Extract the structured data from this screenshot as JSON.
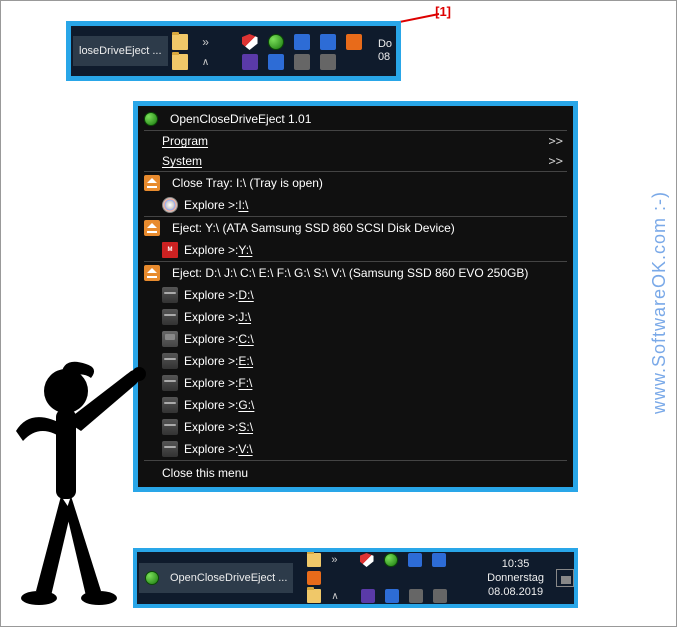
{
  "annotation": {
    "label": "[1]"
  },
  "topbar": {
    "task_label": "loseDriveEject ...",
    "clock": "Do\n08"
  },
  "menu": {
    "title": "OpenCloseDriveEject 1.01",
    "program": {
      "label": "Program",
      "chev": ">>"
    },
    "system": {
      "label": "System",
      "chev": ">>"
    },
    "close_tray": "Close Tray: I:\\ (Tray is open)",
    "explore_i": {
      "pre": "Explore >: ",
      "drive": "I:\\"
    },
    "eject_y": "Eject: Y:\\  (ATA Samsung SSD 860 SCSI Disk Device)",
    "explore_y": {
      "pre": "Explore >: ",
      "drive": "Y:\\"
    },
    "eject_multi": "Eject: D:\\ J:\\ C:\\ E:\\ F:\\ G:\\ S:\\ V:\\  (Samsung SSD 860 EVO 250GB)",
    "explore_d": {
      "pre": "Explore >: ",
      "drive": "D:\\"
    },
    "explore_j": {
      "pre": "Explore >: ",
      "drive": "J:\\"
    },
    "explore_c": {
      "pre": "Explore >: ",
      "drive": "C:\\"
    },
    "explore_e": {
      "pre": "Explore >: ",
      "drive": "E:\\"
    },
    "explore_f": {
      "pre": "Explore >: ",
      "drive": "F:\\"
    },
    "explore_g": {
      "pre": "Explore >: ",
      "drive": "G:\\"
    },
    "explore_s": {
      "pre": "Explore >: ",
      "drive": "S:\\"
    },
    "explore_v": {
      "pre": "Explore >: ",
      "drive": "V:\\"
    },
    "close_menu": "Close this menu"
  },
  "bottombar": {
    "task_label": "OpenCloseDriveEject ...",
    "time": "10:35",
    "day": "Donnerstag",
    "date": "08.08.2019"
  },
  "watermark": "www.SoftwareOK.com :-)"
}
